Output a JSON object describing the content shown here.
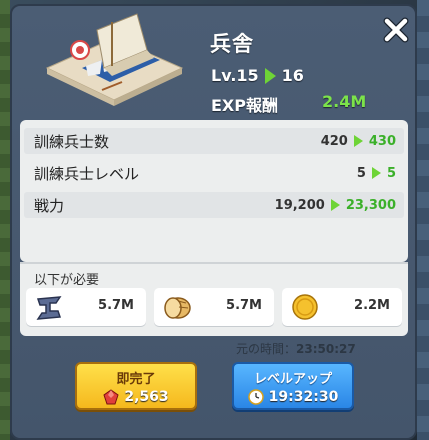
{
  "header": {
    "title": "兵舎",
    "level_current": "Lv.15",
    "level_next": "16",
    "exp_label": "EXP報酬",
    "exp_value": "2.4M"
  },
  "stats": [
    {
      "label": "訓練兵士数",
      "current": "420",
      "next": "430"
    },
    {
      "label": "訓練兵士レベル",
      "current": "5",
      "next": "5"
    },
    {
      "label": "戦力",
      "current": "19,200",
      "next": "23,300"
    }
  ],
  "requirements": {
    "title": "以下が必要",
    "items": [
      {
        "icon": "iron-ingot-icon",
        "amount": "5.7M"
      },
      {
        "icon": "bread-icon",
        "amount": "5.7M"
      },
      {
        "icon": "gold-coin-icon",
        "amount": "2.2M"
      }
    ]
  },
  "original_time": {
    "label": "元の時間：",
    "value": "23:50:27"
  },
  "buttons": {
    "instant": {
      "label": "即完了",
      "cost": "2,563",
      "icon": "ruby-gem-icon"
    },
    "upgrade": {
      "label": "レベルアップ",
      "time": "19:32:30",
      "icon": "clock-icon"
    }
  },
  "colors": {
    "panel": "#4b5d74",
    "accent_green": "#7ce34a",
    "instant_button": "#f5b81d",
    "upgrade_button": "#2a86e6"
  }
}
